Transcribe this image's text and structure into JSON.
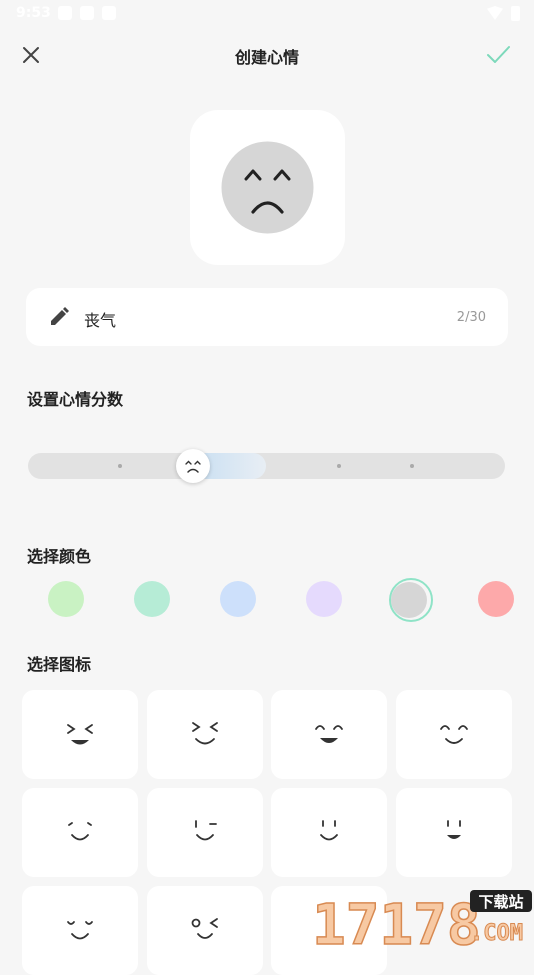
{
  "status": {
    "time": "9:53"
  },
  "header": {
    "title": "创建心情"
  },
  "mood_name": {
    "value": "丧气",
    "count": "2/30"
  },
  "sections": {
    "score_label": "设置心情分数",
    "color_label": "选择颜色",
    "icon_label": "选择图标"
  },
  "slider": {
    "value_fraction": 0.34
  },
  "colors": [
    "#c9f2c3",
    "#b6ecd6",
    "#cde0fb",
    "#e5dafd",
    "#d6d6d6",
    "#fda9aa"
  ],
  "selected_color": "#d6d6d6",
  "accent": "#8fe3c7",
  "watermark": {
    "number": "17178",
    "tag": "下载站",
    "domain": ".COM"
  }
}
